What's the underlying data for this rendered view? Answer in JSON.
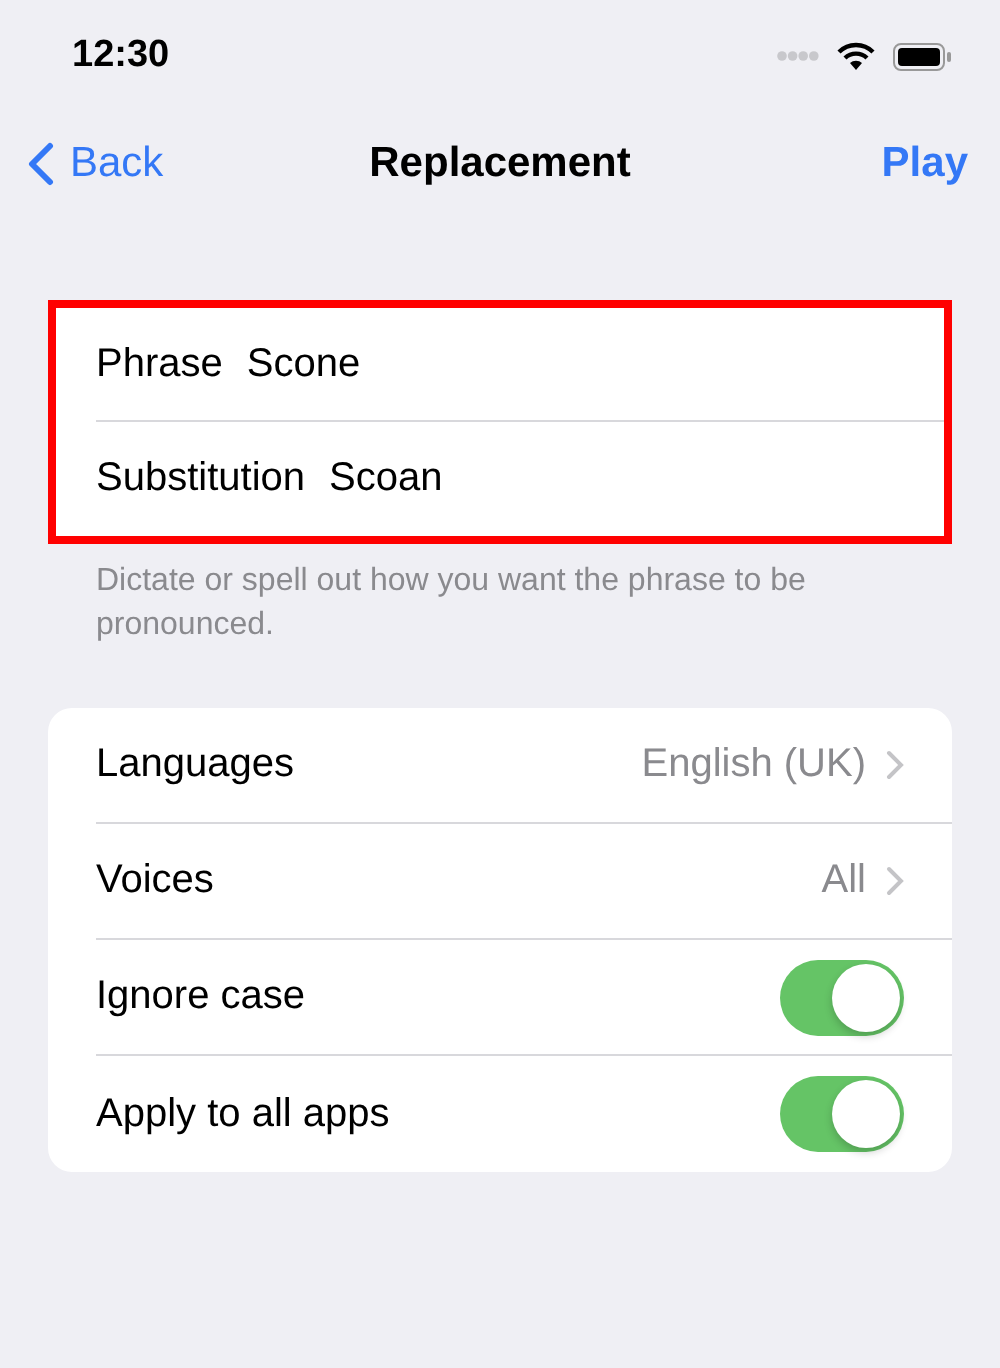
{
  "status_bar": {
    "time": "12:30"
  },
  "nav": {
    "back": "Back",
    "title": "Replacement",
    "action": "Play"
  },
  "entry": {
    "highlighted": true,
    "fields": [
      {
        "label": "Phrase",
        "value": "Scone"
      },
      {
        "label": "Substitution",
        "value": "Scoan"
      }
    ]
  },
  "hint": "Dictate or spell out how you want the phrase to be pronounced.",
  "settings": [
    {
      "kind": "link",
      "label": "Languages",
      "value": "English (UK)"
    },
    {
      "kind": "link",
      "label": "Voices",
      "value": "All"
    },
    {
      "kind": "toggle",
      "label": "Ignore case",
      "on": true
    },
    {
      "kind": "toggle",
      "label": "Apply to all apps",
      "on": true
    }
  ]
}
